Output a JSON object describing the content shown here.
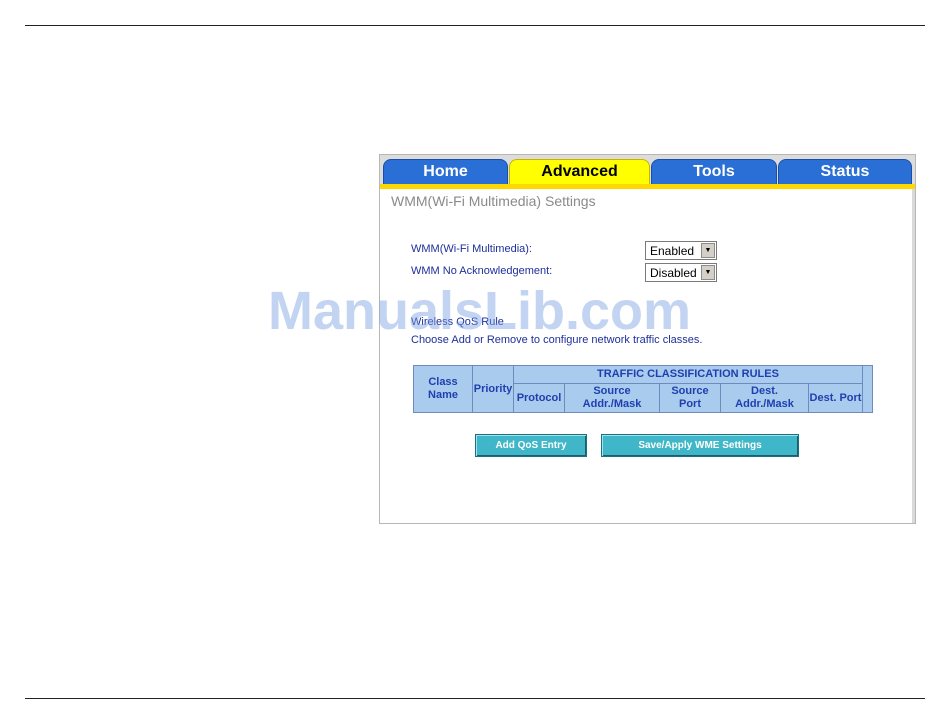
{
  "tabs": [
    {
      "label": "Home",
      "active": false
    },
    {
      "label": "Advanced",
      "active": true
    },
    {
      "label": "Tools",
      "active": false
    },
    {
      "label": "Status",
      "active": false
    }
  ],
  "page_title": "WMM(Wi-Fi Multimedia) Settings",
  "wmm": {
    "label": "WMM(Wi-Fi Multimedia):",
    "value": "Enabled"
  },
  "wmm_no_ack": {
    "label": "WMM No Acknowledgement:",
    "value": "Disabled"
  },
  "section": {
    "heading": "Wireless QoS Rule",
    "description": "Choose Add or Remove to configure network traffic classes."
  },
  "table": {
    "col_class_name": "Class Name",
    "col_priority": "Priority",
    "group_header": "TRAFFIC CLASSIFICATION RULES",
    "col_protocol": "Protocol",
    "col_source_addr": "Source Addr./Mask",
    "col_source_port": "Source Port",
    "col_dest_addr": "Dest. Addr./Mask",
    "col_dest_port": "Dest. Port"
  },
  "buttons": {
    "add": "Add QoS Entry",
    "save": "Save/Apply WME Settings"
  },
  "watermark": "ManualsLib.com",
  "colors": {
    "tab_blue": "#2a6fd6",
    "tab_active": "#ffff00",
    "accent_line": "#ffd800",
    "label_blue": "#1e2f9a",
    "table_bg": "#a9cbed",
    "button_teal": "#3fb7c8"
  }
}
